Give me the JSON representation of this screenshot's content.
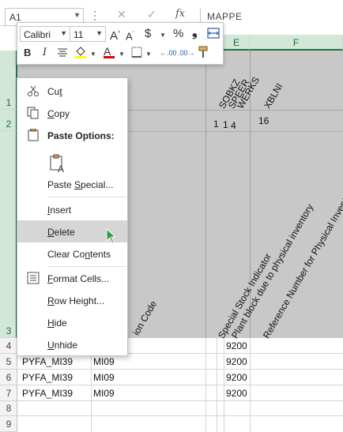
{
  "formula_bar": {
    "name_box": "A1",
    "formula_text": "MAPPE",
    "cancel_glyph": "✕",
    "enter_glyph": "✓",
    "fx_label": "fx"
  },
  "columns": [
    "E",
    "F"
  ],
  "rows": [
    "1",
    "2",
    "3",
    "4",
    "5",
    "6",
    "7",
    "8",
    "9"
  ],
  "header_fields": {
    "rotated_row1": [
      "SOBKZ",
      "SPEER",
      "WERKS",
      "XBLNI"
    ],
    "row2": [
      "1",
      "1",
      "4",
      "16"
    ],
    "row3": [
      "ion Code",
      "Special Stock Indicator",
      "Plant block due to physical inventory",
      "Reference Number for Physical Inventory"
    ]
  },
  "data_rows": [
    {
      "row": "4",
      "a": "",
      "b": "",
      "e": "9200"
    },
    {
      "row": "5",
      "a": "PYFA_MI39",
      "b": "MI09",
      "e": "9200"
    },
    {
      "row": "6",
      "a": "PYFA_MI39",
      "b": "MI09",
      "e": "9200"
    },
    {
      "row": "7",
      "a": "PYFA_MI39",
      "b": "MI09",
      "e": "9200"
    }
  ],
  "mini_toolbar": {
    "font_name": "Calibri",
    "font_size": "11",
    "grow_font": "A",
    "shrink_font": "A",
    "currency": "$",
    "percent": "%",
    "comma": "❟",
    "bold": "B",
    "italic": "I",
    "font_color_letter": "A",
    "highlight_color": "#ffff00",
    "font_color": "#e00000",
    "decrease_decimal": "←.00",
    "increase_decimal": ".00→"
  },
  "context_menu": {
    "cut": {
      "pre": "Cu",
      "key": "t",
      "post": ""
    },
    "copy": {
      "pre": "",
      "key": "C",
      "post": "opy"
    },
    "paste_options": "Paste Options:",
    "paste_special": {
      "pre": "Paste ",
      "key": "S",
      "post": "pecial..."
    },
    "insert": {
      "pre": "",
      "key": "I",
      "post": "nsert"
    },
    "delete": {
      "pre": "",
      "key": "D",
      "post": "elete"
    },
    "clear_contents": {
      "pre": "Clear Co",
      "key": "n",
      "post": "tents"
    },
    "format_cells": {
      "pre": "",
      "key": "F",
      "post": "ormat Cells..."
    },
    "row_height": {
      "pre": "",
      "key": "R",
      "post": "ow Height..."
    },
    "hide": {
      "pre": "",
      "key": "H",
      "post": "ide"
    },
    "unhide": {
      "pre": "",
      "key": "U",
      "post": "nhide"
    }
  },
  "colors": {
    "selection_green": "#217346",
    "header_gray": "#c8c8c8",
    "hover_gray": "#d6d6d6",
    "cursor_green": "#2e9c46"
  }
}
